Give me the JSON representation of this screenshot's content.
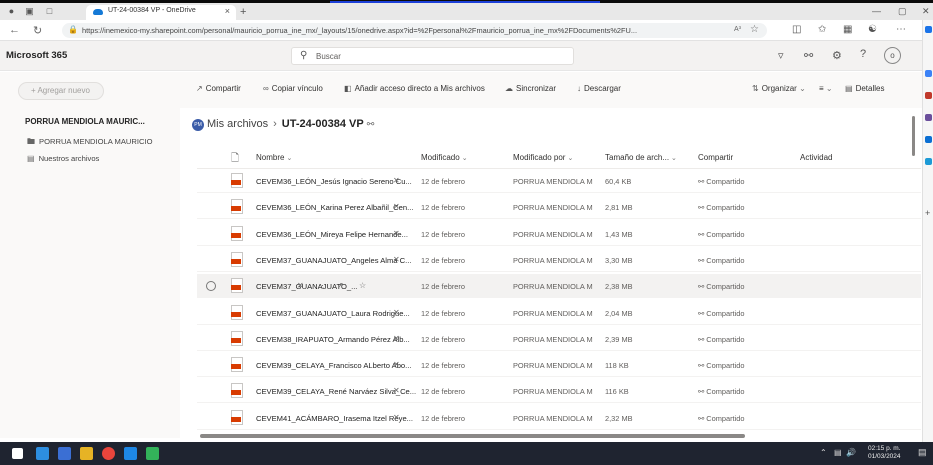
{
  "browser": {
    "tab_title": "UT-24-00384 VP - OneDrive",
    "tab_close": "×",
    "new_tab": "+",
    "url": "https://inemexico-my.sharepoint.com/personal/mauricio_porrua_ine_mx/_layouts/15/onedrive.aspx?id=%2Fpersonal%2Fmauricio_porrua_ine_mx%2FDocuments%2FU...",
    "read_aloud": "A³",
    "minimize": "—",
    "restore": "▢",
    "close": "✕"
  },
  "header": {
    "brand": "Microsoft 365",
    "search_placeholder": "Buscar",
    "help": "?"
  },
  "commands": {
    "add_new": "+ Agregar nuevo",
    "share": "Compartir",
    "copy_link": "Copiar vínculo",
    "add_shortcut": "Añadir acceso directo a Mis archivos",
    "sync": "Sincronizar",
    "download": "Descargar",
    "organize": "Organizar",
    "view": "≡",
    "details": "Detalles"
  },
  "leftnav": {
    "user": "PORRUA MENDIOLA MAURIC...",
    "items": [
      {
        "label": "PORRUA MENDIOLA MAURICIO"
      },
      {
        "label": "Nuestros archivos"
      }
    ]
  },
  "breadcrumb": {
    "badge": "PM",
    "root": "Mis archivos",
    "sep": "›",
    "current": "UT-24-00384 VP"
  },
  "columns": {
    "name": "Nombre",
    "modified": "Modificado",
    "modified_by": "Modificado por",
    "size": "Tamaño de arch...",
    "sharing": "Compartir",
    "activity": "Actividad"
  },
  "files": [
    {
      "name": "CEVEM36_LEÓN_Jesús Ignacio Sereno Cu...",
      "date": "12 de febrero",
      "by": "PORRUA MENDIOLA M",
      "size": "60,4 KB",
      "sharing": "Compartido"
    },
    {
      "name": "CEVEM36_LEÓN_Karina Perez Albañil_Cen...",
      "date": "12 de febrero",
      "by": "PORRUA MENDIOLA M",
      "size": "2,81 MB",
      "sharing": "Compartido"
    },
    {
      "name": "CEVEM36_LEÓN_Mireya Felipe Hernande...",
      "date": "12 de febrero",
      "by": "PORRUA MENDIOLA M",
      "size": "1,43 MB",
      "sharing": "Compartido"
    },
    {
      "name": "CEVEM37_GUANAJUATO_Angeles Alma C...",
      "date": "12 de febrero",
      "by": "PORRUA MENDIOLA M",
      "size": "3,30 MB",
      "sharing": "Compartido"
    },
    {
      "name": "CEVEM37_GUANAJUATO_...",
      "date": "12 de febrero",
      "by": "PORRUA MENDIOLA M",
      "size": "2,38 MB",
      "sharing": "Compartido",
      "more": "···"
    },
    {
      "name": "CEVEM37_GUANAJUATO_Laura Rodrigue...",
      "date": "12 de febrero",
      "by": "PORRUA MENDIOLA M",
      "size": "2,04 MB",
      "sharing": "Compartido"
    },
    {
      "name": "CEVEM38_IRAPUATO_Armando Pérez Alb...",
      "date": "12 de febrero",
      "by": "PORRUA MENDIOLA M",
      "size": "2,39 MB",
      "sharing": "Compartido"
    },
    {
      "name": "CEVEM39_CELAYA_Francisco ALberto Abo...",
      "date": "12 de febrero",
      "by": "PORRUA MENDIOLA M",
      "size": "118 KB",
      "sharing": "Compartido"
    },
    {
      "name": "CEVEM39_CELAYA_René Narváez Silva_Ce...",
      "date": "12 de febrero",
      "by": "PORRUA MENDIOLA M",
      "size": "116 KB",
      "sharing": "Compartido"
    },
    {
      "name": "CEVEM41_ACÁMBARO_Irasema Itzel Reye...",
      "date": "12 de febrero",
      "by": "PORRUA MENDIOLA M",
      "size": "2,32 MB",
      "sharing": "Compartido"
    }
  ],
  "taskbar": {
    "time": "02:15 p. m.",
    "date": "01/03/2024"
  },
  "colors": {
    "pdf_red": "#d83b01",
    "taskbar": "#1f2430",
    "accent": "#1479d6"
  }
}
